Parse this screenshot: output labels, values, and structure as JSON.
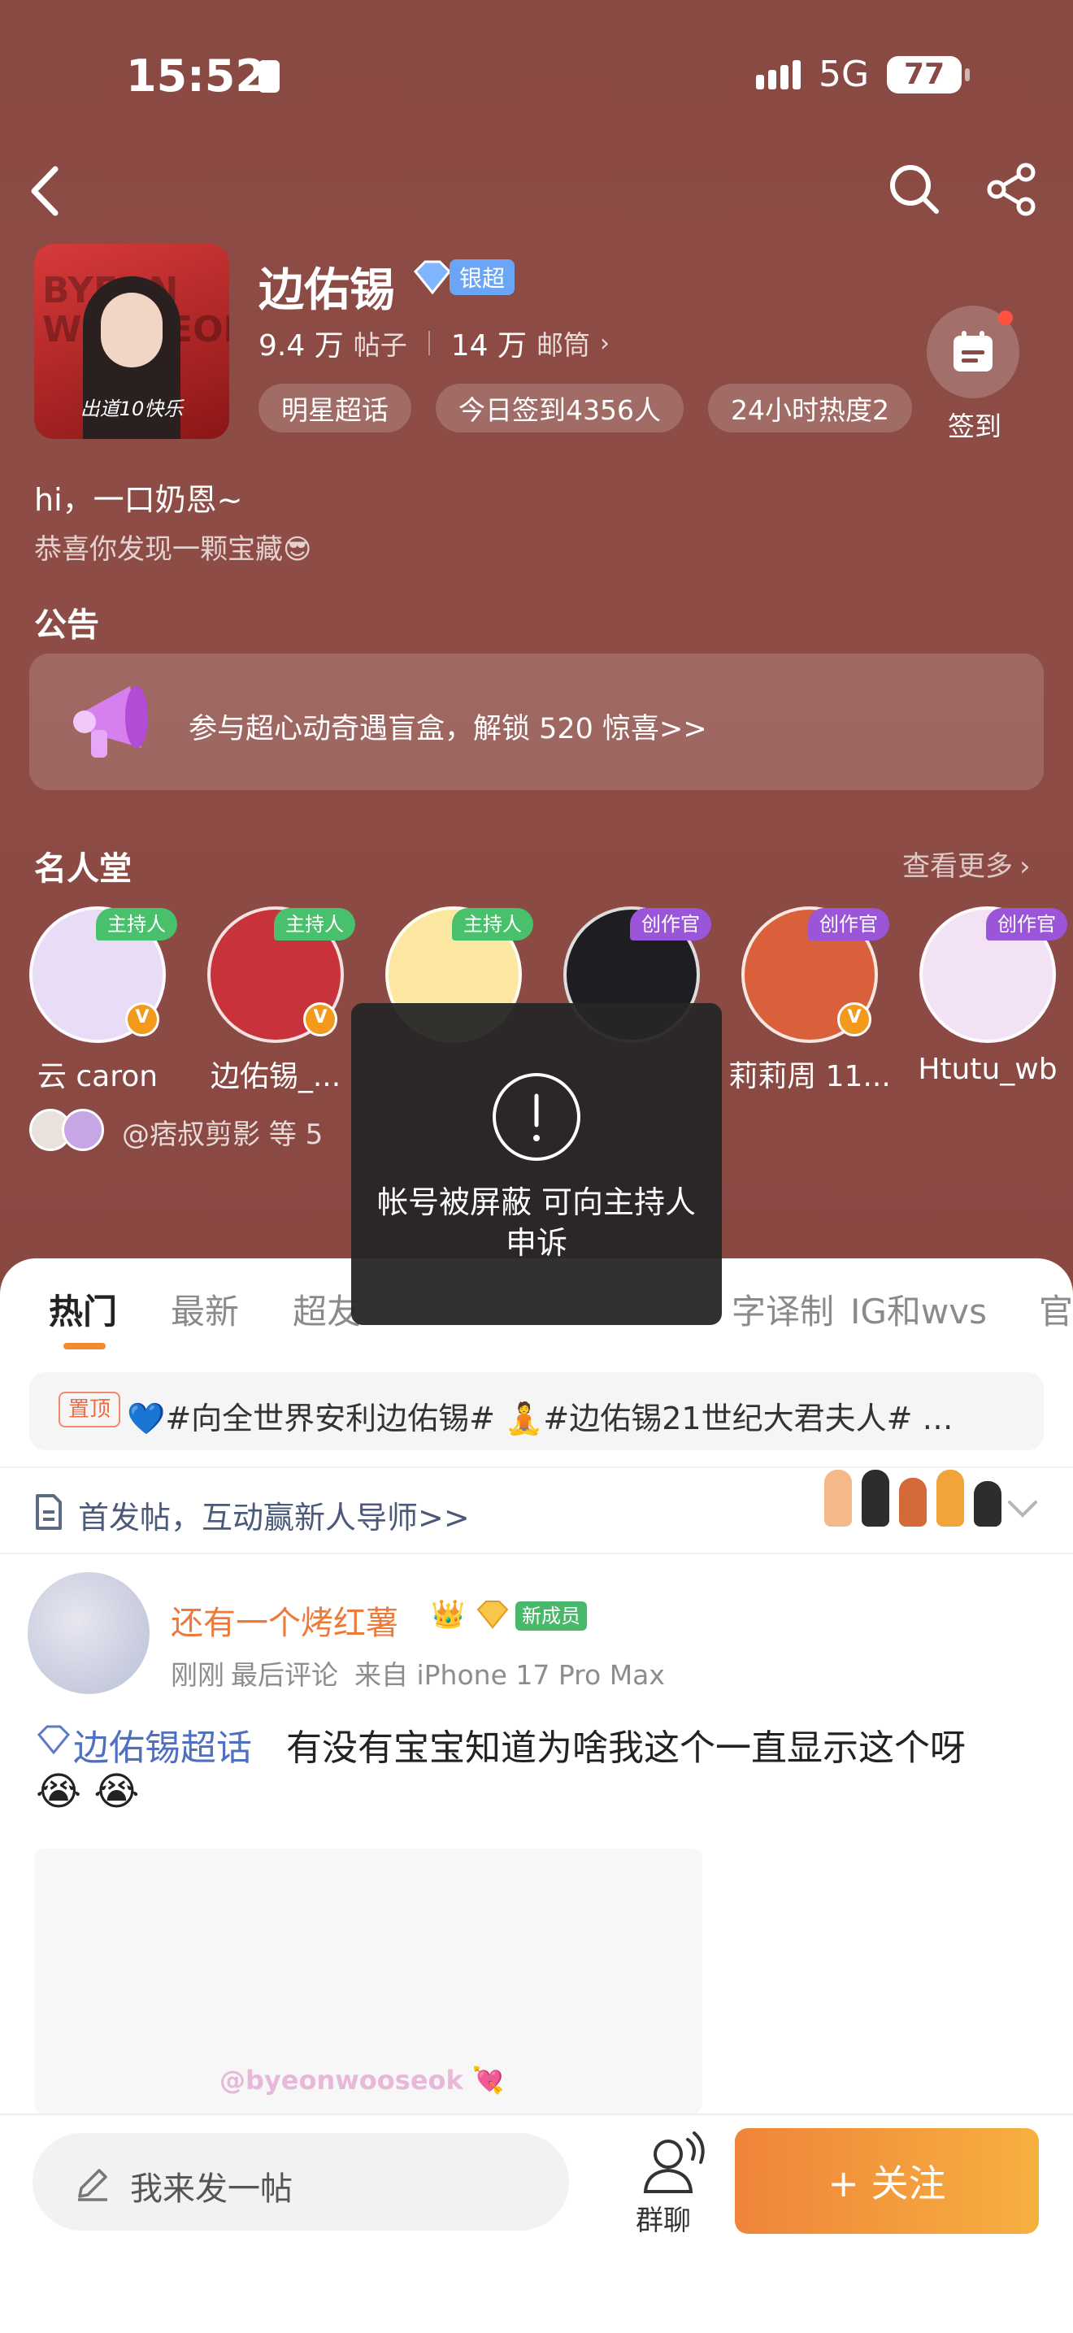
{
  "status": {
    "time": "15:52",
    "network": "5G",
    "battery": "77"
  },
  "header": {
    "back_icon": "chevron-left-icon",
    "search_icon": "search-icon",
    "share_icon": "share-icon"
  },
  "profile": {
    "avatar_caption": "出道10快乐",
    "name": "边佑锡",
    "level_badge": "银超",
    "posts_count": "9.4 万",
    "posts_label": "帖子",
    "followers_count": "14 万",
    "followers_label": "邮筒",
    "tags": [
      "明星超话",
      "今日签到4356人",
      "24小时热度2"
    ],
    "checkin_label": "签到",
    "intro_line1": "hi，一口奶恩~",
    "intro_line2": "恭喜你发现一颗宝藏😎"
  },
  "notice": {
    "title": "公告",
    "text": "参与超心动奇遇盲盒，解锁 520 惊喜>>"
  },
  "hall": {
    "title": "名人堂",
    "more": "查看更多",
    "members": [
      {
        "name": "云 caron",
        "role": "主持人",
        "color": "#e8dcf6"
      },
      {
        "name": "边佑锡_...",
        "role": "主持人",
        "color": "#c8323a"
      },
      {
        "name": "",
        "role": "主持人",
        "color": "#fbe7a0"
      },
      {
        "name": "",
        "role": "创作官",
        "color": "#1d1d22"
      },
      {
        "name": "莉莉周 11...",
        "role": "创作官",
        "color": "#d9603a"
      },
      {
        "name": "Htutu_wb",
        "role": "创作官",
        "color": "#f2e2f4"
      }
    ],
    "fans_text": "@痞叔剪影 等 5"
  },
  "toast": {
    "icon": "exclamation-icon",
    "message": "帐号被屏蔽 可向主持人申诉"
  },
  "tabs": [
    "热门",
    "最新",
    "超友",
    "",
    "字译制",
    "IG和wvs",
    "官"
  ],
  "pinned": {
    "tag": "置顶",
    "text": "💙#向全世界安利边佑锡# 🧘#边佑锡21世纪大君夫人# …"
  },
  "newbie_banner": {
    "text": "首发帖，互动赢新人导师>>"
  },
  "post": {
    "author": "还有一个烤红薯",
    "new_badge": "新成员",
    "meta_time": "刚刚",
    "meta_comment": "最后评论",
    "meta_source": "来自 iPhone 17 Pro Max",
    "topic": "边佑锡超话",
    "content": "有没有宝宝知道为啥我这个一直显示这个呀",
    "emojis": "😭 😭",
    "image_watermark": "@byeonwooseok 💘"
  },
  "bottom": {
    "compose_placeholder": "我来发一帖",
    "group_label": "群聊",
    "follow_label": "+ 关注"
  }
}
